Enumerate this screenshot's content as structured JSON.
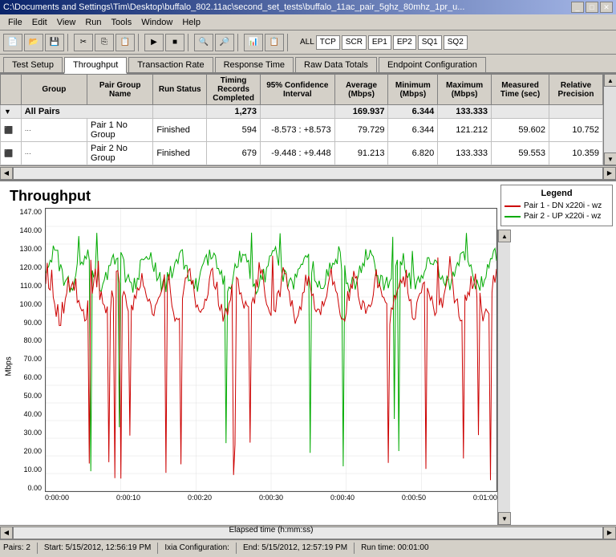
{
  "window": {
    "title": "C:\\Documents and Settings\\Tim\\Desktop\\buffalo_802.11ac\\second_set_tests\\buffalo_11ac_pair_5ghz_80mhz_1pr_u...",
    "title_short": "C:\\Documents and Settings\\Tim\\Desktop\\buffalo_802.11ac\\second_set_tests\\buffalo_11ac_pair_5ghz_80mhz_1pr_u..."
  },
  "menu": {
    "items": [
      "File",
      "Edit",
      "View",
      "Run",
      "Tools",
      "Window",
      "Help"
    ]
  },
  "toolbar": {
    "labels": [
      "ALL",
      "TCP",
      "SCR",
      "EP1",
      "EP2",
      "SQ1",
      "SQ2"
    ]
  },
  "tabs": {
    "items": [
      "Test Setup",
      "Throughput",
      "Transaction Rate",
      "Response Time",
      "Raw Data Totals",
      "Endpoint Configuration"
    ],
    "active": "Throughput"
  },
  "table": {
    "headers": [
      "Group",
      "Pair Group Name",
      "Run Status",
      "Timing Records Completed",
      "95% Confidence Interval",
      "Average (Mbps)",
      "Minimum (Mbps)",
      "Maximum (Mbps)",
      "Measured Time (sec)",
      "Relative Precision"
    ],
    "rows": [
      {
        "type": "group",
        "group": "",
        "name": "All Pairs",
        "status": "",
        "records": "1,273",
        "confidence": "",
        "average": "169.937",
        "minimum": "6.344",
        "maximum": "133.333",
        "measured": "",
        "precision": ""
      },
      {
        "type": "pair",
        "group": "",
        "name": "Pair 1  No Group",
        "status": "Finished",
        "records": "594",
        "confidence": "-8.573 : +8.573",
        "average": "79.729",
        "minimum": "6.344",
        "maximum": "121.212",
        "measured": "59.602",
        "precision": "10.752"
      },
      {
        "type": "pair",
        "group": "",
        "name": "Pair 2  No Group",
        "status": "Finished",
        "records": "679",
        "confidence": "-9.448 : +9.448",
        "average": "91.213",
        "minimum": "6.820",
        "maximum": "133.333",
        "measured": "59.553",
        "precision": "10.359"
      }
    ]
  },
  "chart": {
    "title": "Throughput",
    "y_axis_label": "Mbps",
    "x_axis_label": "Elapsed time (h:mm:ss)",
    "y_ticks": [
      "0.00",
      "10.00",
      "20.00",
      "30.00",
      "40.00",
      "50.00",
      "60.00",
      "70.00",
      "80.00",
      "90.00",
      "100.00",
      "110.00",
      "120.00",
      "130.00",
      "140.00",
      "147.00"
    ],
    "x_ticks": [
      "0:00:00",
      "0:00:10",
      "0:00:20",
      "0:00:30",
      "0:00:40",
      "0:00:50",
      "0:01:00"
    ],
    "legend": {
      "title": "Legend",
      "items": [
        {
          "label": "Pair 1 - DN x220i - wz",
          "color": "#cc0000"
        },
        {
          "label": "Pair 2 - UP x220i - wz",
          "color": "#00aa00"
        }
      ]
    }
  },
  "status_bar": {
    "pairs": "Pairs: 2",
    "start": "Start: 5/15/2012, 12:56:19 PM",
    "ixia": "Ixia Configuration:",
    "end": "End: 5/15/2012, 12:57:19 PM",
    "runtime": "Run time: 00:01:00"
  }
}
